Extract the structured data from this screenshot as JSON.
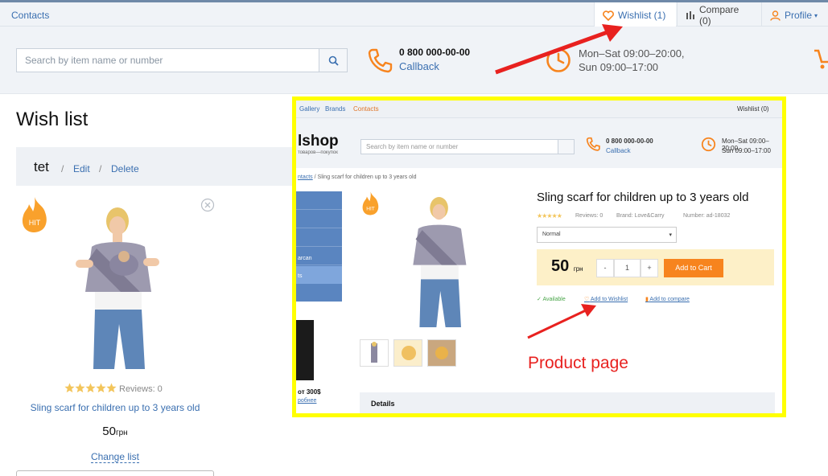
{
  "topbar": {
    "contacts": "Contacts",
    "wishlist": "Wishlist (1)",
    "compare": "Compare (0)",
    "profile": "Profile"
  },
  "header": {
    "search_placeholder": "Search by item name or number",
    "phone": "0 800 000-00-00",
    "callback": "Callback",
    "hours_line1": "Mon–Sat 09:00–20:00,",
    "hours_line2": "Sun 09:00–17:00"
  },
  "wishlist": {
    "title": "Wish list",
    "list_name": "tet",
    "edit": "Edit",
    "delete": "Delete",
    "item": {
      "badge": "HIT",
      "rating": 5,
      "reviews": "Reviews: 0",
      "name": "Sling scarf for children up to 3 years old",
      "price": "50",
      "currency": "грн",
      "change_list": "Change list"
    }
  },
  "inset": {
    "topbar": {
      "gallery": "Gallery",
      "brands": "Brands",
      "contacts": "Contacts",
      "wishlist": "Wishlist (0)"
    },
    "logo": "lshop",
    "logo_sub": "товаров—покупок",
    "search_placeholder": "Search by item name or number",
    "phone": "0 800 000-00-00",
    "callback": "Callback",
    "hours_line1": "Mon–Sat 09:00–20:00",
    "hours_line2": "Sun 09:00–17:00",
    "breadcrumb_link": "ntacts",
    "breadcrumb_rest": "/ Sling scarf for children up to 3 years old",
    "sidebar_items": [
      "arcan",
      "ts"
    ],
    "ad_price": "от 300$",
    "ad_link": "робнее",
    "badge": "HIT",
    "product_title": "Sling scarf for children up to 3 years old",
    "reviews": "Reviews: 0",
    "brand": "Brand: Love&Carry",
    "number": "Number: ad-18032",
    "variant": "Normal",
    "price": "50",
    "currency": "грн",
    "qty": "1",
    "minus": "-",
    "plus": "+",
    "add_to_cart": "Add to Cart",
    "available": "Available",
    "add_to_wishlist": "Add to Wishlist",
    "add_to_compare": "Add to compare",
    "details": "Details"
  },
  "annotation": "Product page",
  "colors": {
    "link": "#3a6fb0",
    "accent_orange": "#f7841e",
    "highlight_yellow": "#ffff00",
    "arrow_red": "#e8211f"
  }
}
